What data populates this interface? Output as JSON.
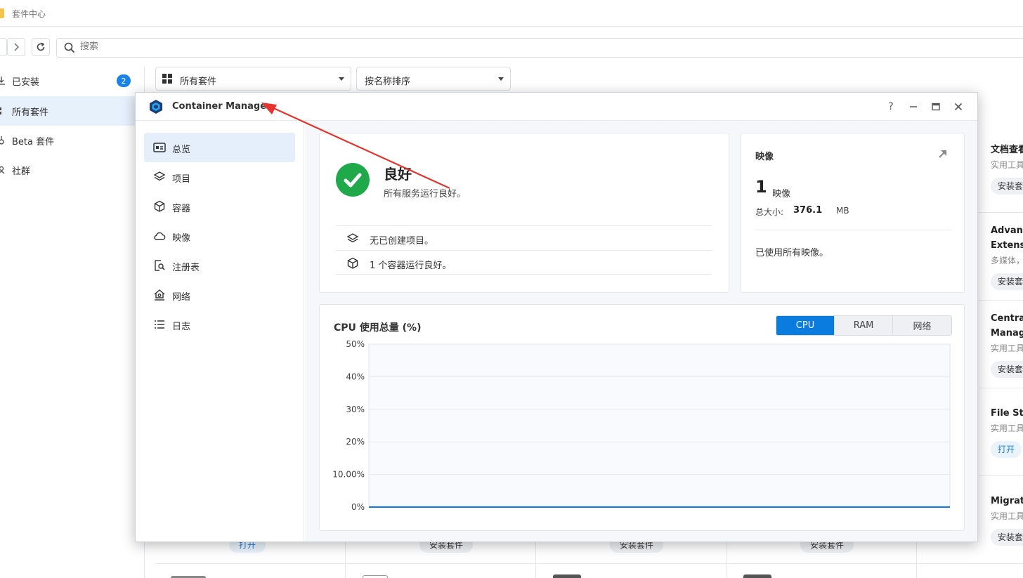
{
  "app": {
    "title": "套件中心"
  },
  "search": {
    "placeholder": "搜索"
  },
  "sidebar": {
    "items": [
      {
        "label": "已安装",
        "badge": "2"
      },
      {
        "label": "所有套件"
      },
      {
        "label": "Beta 套件"
      },
      {
        "label": "社群"
      }
    ]
  },
  "filters": {
    "category": "所有套件",
    "sort": "按名称排序"
  },
  "right_cards": [
    {
      "name": "文档查看",
      "category": "实用工具",
      "button": "安装套件"
    },
    {
      "name": "Advanced Extensions",
      "category": "多媒体，",
      "button": "安装套件"
    },
    {
      "name": "Central Management",
      "category": "实用工具",
      "button": "安装套件"
    },
    {
      "name": "File Station",
      "category": "实用工具",
      "button": "打开"
    },
    {
      "name": "Migration",
      "category": "实用工具",
      "button": "安装套件"
    }
  ],
  "bottom_buttons": [
    "打开",
    "安装套件",
    "安装套件",
    "安装套件"
  ],
  "window": {
    "title": "Container Manager",
    "help": "?",
    "nav": [
      {
        "label": "总览"
      },
      {
        "label": "项目"
      },
      {
        "label": "容器"
      },
      {
        "label": "映像"
      },
      {
        "label": "注册表"
      },
      {
        "label": "网络"
      },
      {
        "label": "日志"
      }
    ],
    "status": {
      "title": "良好",
      "subtitle": "所有服务运行良好。",
      "rows": [
        "无已创建项目。",
        "1 个容器运行良好。"
      ]
    },
    "images": {
      "title": "映像",
      "count": "1",
      "unit": "映像",
      "size_label": "总大小:",
      "size_value": "376.1",
      "size_unit": "MB",
      "note": "已使用所有映像。"
    },
    "chart_tabs": [
      "CPU",
      "RAM",
      "网络"
    ],
    "active_tab": "CPU"
  },
  "colors": {
    "accent": "#0a7cdf",
    "success": "#1fa94a",
    "annotation": "#e8322b"
  },
  "chart_data": {
    "type": "line",
    "title": "CPU 使用总量 (%)",
    "xlabel": "",
    "ylabel": "",
    "ylim": [
      0,
      50
    ],
    "y_ticks": [
      {
        "value": 50,
        "label": "50%"
      },
      {
        "value": 40,
        "label": "40%"
      },
      {
        "value": 30,
        "label": "30%"
      },
      {
        "value": 20,
        "label": "20%"
      },
      {
        "value": 10,
        "label": "10.00%"
      },
      {
        "value": 0,
        "label": "0%"
      }
    ],
    "grid": true,
    "series": [
      {
        "values": [
          0,
          0,
          0,
          0,
          0,
          0,
          0,
          0,
          0,
          0,
          0,
          0
        ]
      }
    ]
  }
}
